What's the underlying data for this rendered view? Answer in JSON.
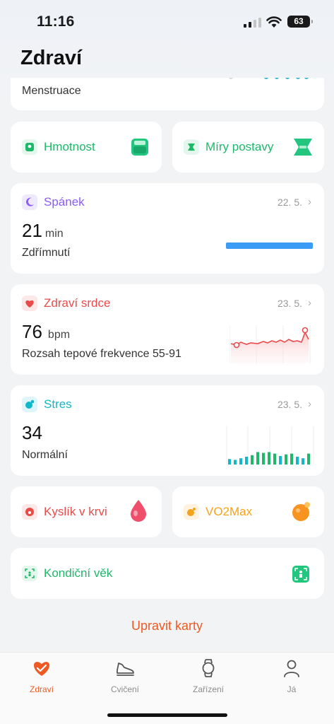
{
  "status_bar": {
    "time": "11:16",
    "battery": "63"
  },
  "page": {
    "title": "Zdraví"
  },
  "cards": {
    "menstruace": {
      "label": "Menstruace"
    },
    "hmotnost": {
      "label": "Hmotnost"
    },
    "miry": {
      "label": "Míry postavy"
    },
    "spanek": {
      "title": "Spánek",
      "date": "22. 5.",
      "value": "21",
      "unit": "min",
      "sub": "Zdřímnutí"
    },
    "srdce": {
      "title": "Zdraví srdce",
      "date": "23. 5.",
      "value": "76",
      "unit": "bpm",
      "sub": "Rozsah tepové frekvence 55-91"
    },
    "stres": {
      "title": "Stres",
      "date": "23. 5.",
      "value": "34",
      "sub": "Normální",
      "bars": [
        0.35,
        0.3,
        0.4,
        0.5,
        0.6,
        0.8,
        0.75,
        0.8,
        0.7,
        0.55,
        0.65,
        0.7,
        0.5,
        0.4,
        0.7
      ]
    },
    "kyslik": {
      "label": "Kyslík v krvi"
    },
    "vo2max": {
      "label": "VO2Max"
    },
    "kondicni": {
      "label": "Kondiční věk"
    }
  },
  "edit_cards": "Upravit karty",
  "colors": {
    "accent": "#ee5a24",
    "green": "#1fb86a",
    "purple": "#8b5cf6",
    "red": "#e94b4b",
    "teal": "#12b7c9",
    "orange": "#f5a31a",
    "blue": "#3b9cf5"
  },
  "tabs": [
    {
      "label": "Zdraví",
      "icon": "heart-icon",
      "active": true
    },
    {
      "label": "Cvičení",
      "icon": "shoe-icon",
      "active": false
    },
    {
      "label": "Zařízení",
      "icon": "watch-icon",
      "active": false
    },
    {
      "label": "Já",
      "icon": "person-icon",
      "active": false
    }
  ]
}
